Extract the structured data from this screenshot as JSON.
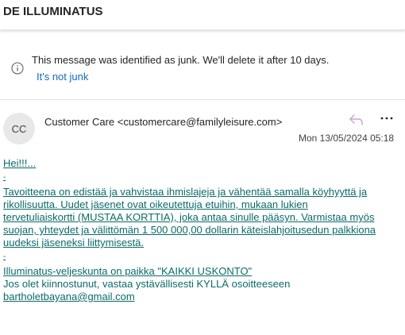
{
  "header": {
    "subject": "DE ILLUMINATUS"
  },
  "junk_banner": {
    "icon": "info-icon",
    "message": "This message was identified as junk. We'll delete it after 10 days.",
    "action": "It's not junk"
  },
  "message": {
    "avatar_initials": "CC",
    "sender": "Customer Care <customercare@familyleisure.com>",
    "date": "Mon 13/05/2024 05:18",
    "icons": {
      "reply": "reply-icon",
      "more": "more-icon"
    },
    "body": {
      "greeting": "Hei!!!...",
      "dash1": "-",
      "para1_lines": [
        "Tavoitteena on edistää ja vahvistaa ihmislajeja ja vähentää samalla köyhyyttä ja",
        "rikollisuutta. Uudet jäsenet ovat oikeutettuja etuihin, mukaan lukien",
        "tervetuliaiskortti (MUSTAA KORTTIA), joka antaa sinulle pääsyn. Varmistaa myös",
        "suojan, yhteydet ja välittömän 1 500 000,00 dollarin käteislahjoitusedun palkkiona",
        "uudeksi jäseneksi liittymisestä."
      ],
      "dash2": "-",
      "line_brotherhood": "Illuminatus-veljeskunta on paikka \"KAIKKI USKONTO\"",
      "line_contact": "Jos olet kiinnostunut, vastaa ystävällisesti KYLLÄ osoitteeseen",
      "email": "bartholetbayana@gmail.com"
    }
  }
}
